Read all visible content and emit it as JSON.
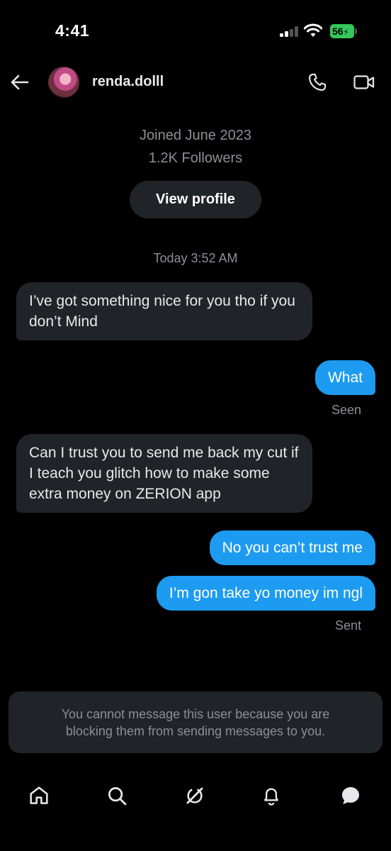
{
  "status": {
    "time": "4:41",
    "battery": "56"
  },
  "header": {
    "username": "renda.dolll"
  },
  "profile": {
    "joined": "Joined June 2023",
    "followers": "1.2K Followers",
    "view_profile_label": "View profile"
  },
  "conversation": {
    "date_stamp": "Today 3:52 AM",
    "messages": [
      {
        "from": "them",
        "text": "I’ve got something nice for you tho if you don’t Mind"
      },
      {
        "from": "me",
        "text": "What",
        "status": "Seen"
      },
      {
        "from": "them",
        "text": "Can I trust you to send me back my cut if I teach you glitch how to make some extra money on ZERION app"
      },
      {
        "from": "me",
        "text": "No you can’t trust me"
      },
      {
        "from": "me",
        "text": "I’m gon take yo money im ngl",
        "status": "Sent"
      }
    ]
  },
  "blocked_notice": "You cannot message this user because you are blocking them from sending messages to you.",
  "bottom_nav": {
    "items": [
      "home-icon",
      "search-icon",
      "grok-icon",
      "notifications-icon",
      "messages-icon"
    ],
    "active": "messages-icon"
  },
  "colors": {
    "accent": "#1d9bf0",
    "bubble_in": "#202327",
    "background": "#000000",
    "battery": "#34c759"
  }
}
